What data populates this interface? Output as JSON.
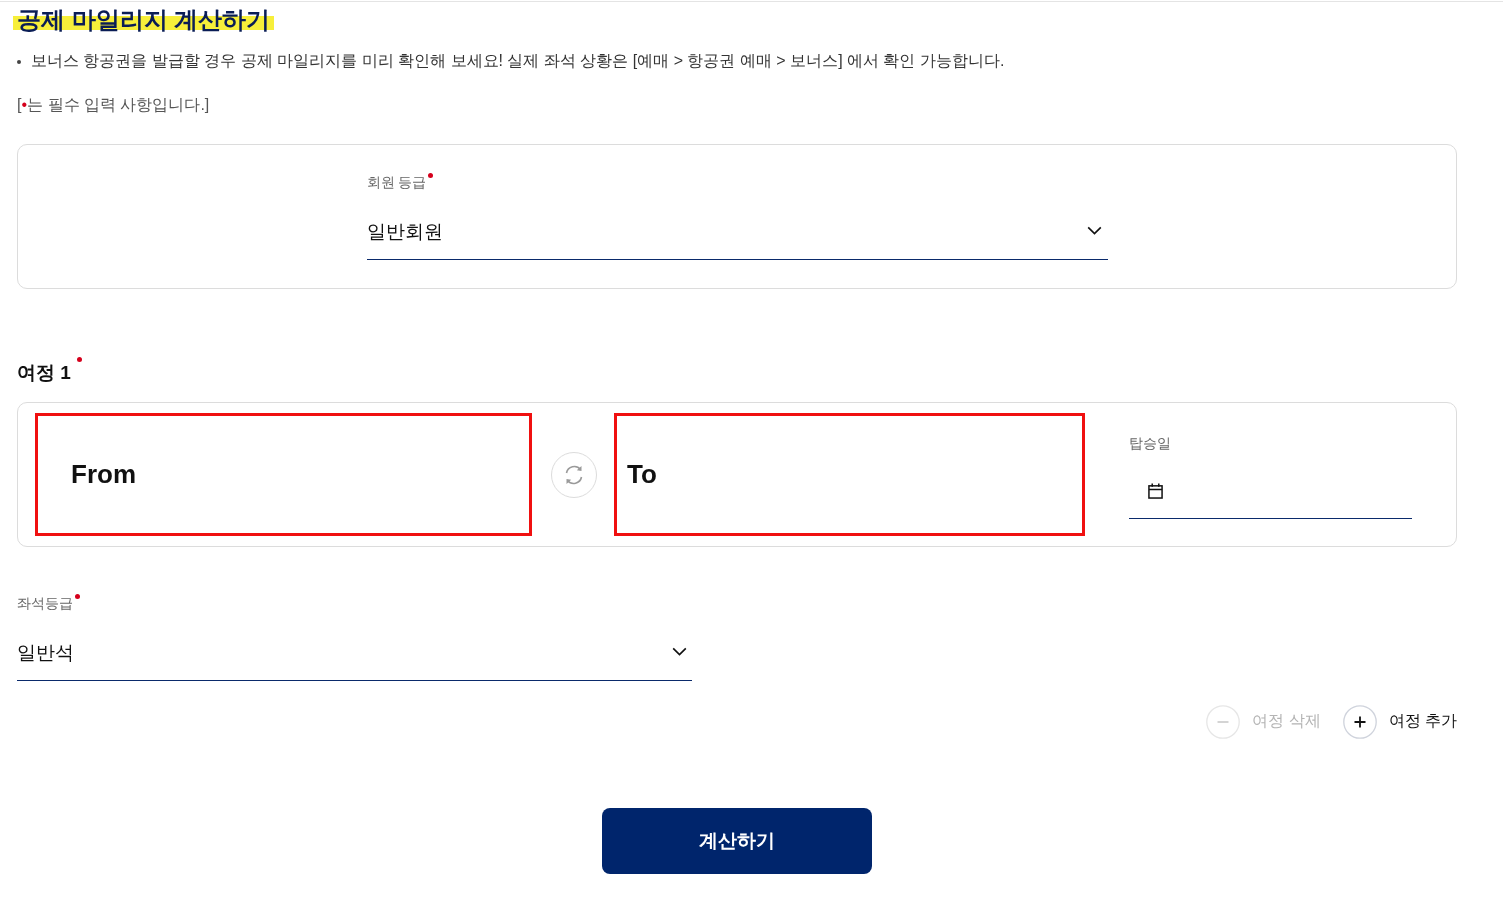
{
  "title": "공제 마일리지 계산하기",
  "notice": "보너스 항공권을 발급할 경우 공제 마일리지를 미리 확인해 보세요! 실제 좌석 상황은 [예매 > 항공권 예매 > 보너스] 에서 확인 가능합니다.",
  "required_note": {
    "before": "[",
    "mark": "•",
    "after": "는 필수 입력 사항입니다.]"
  },
  "member_grade": {
    "label": "회원 등급",
    "required": true,
    "value": "일반회원"
  },
  "segments": [
    {
      "title": "여정 1",
      "required": true,
      "from": "From",
      "to": "To",
      "date": {
        "label": "탑승일"
      }
    }
  ],
  "seat_class": {
    "label": "좌석등급",
    "required": true,
    "value": "일반석"
  },
  "segment_actions": [
    {
      "kind": "remove",
      "label": "여정 삭제",
      "disabled": true
    },
    {
      "kind": "add",
      "label": "여정 추가",
      "disabled": false
    }
  ],
  "submit": {
    "label": "계산하기"
  }
}
